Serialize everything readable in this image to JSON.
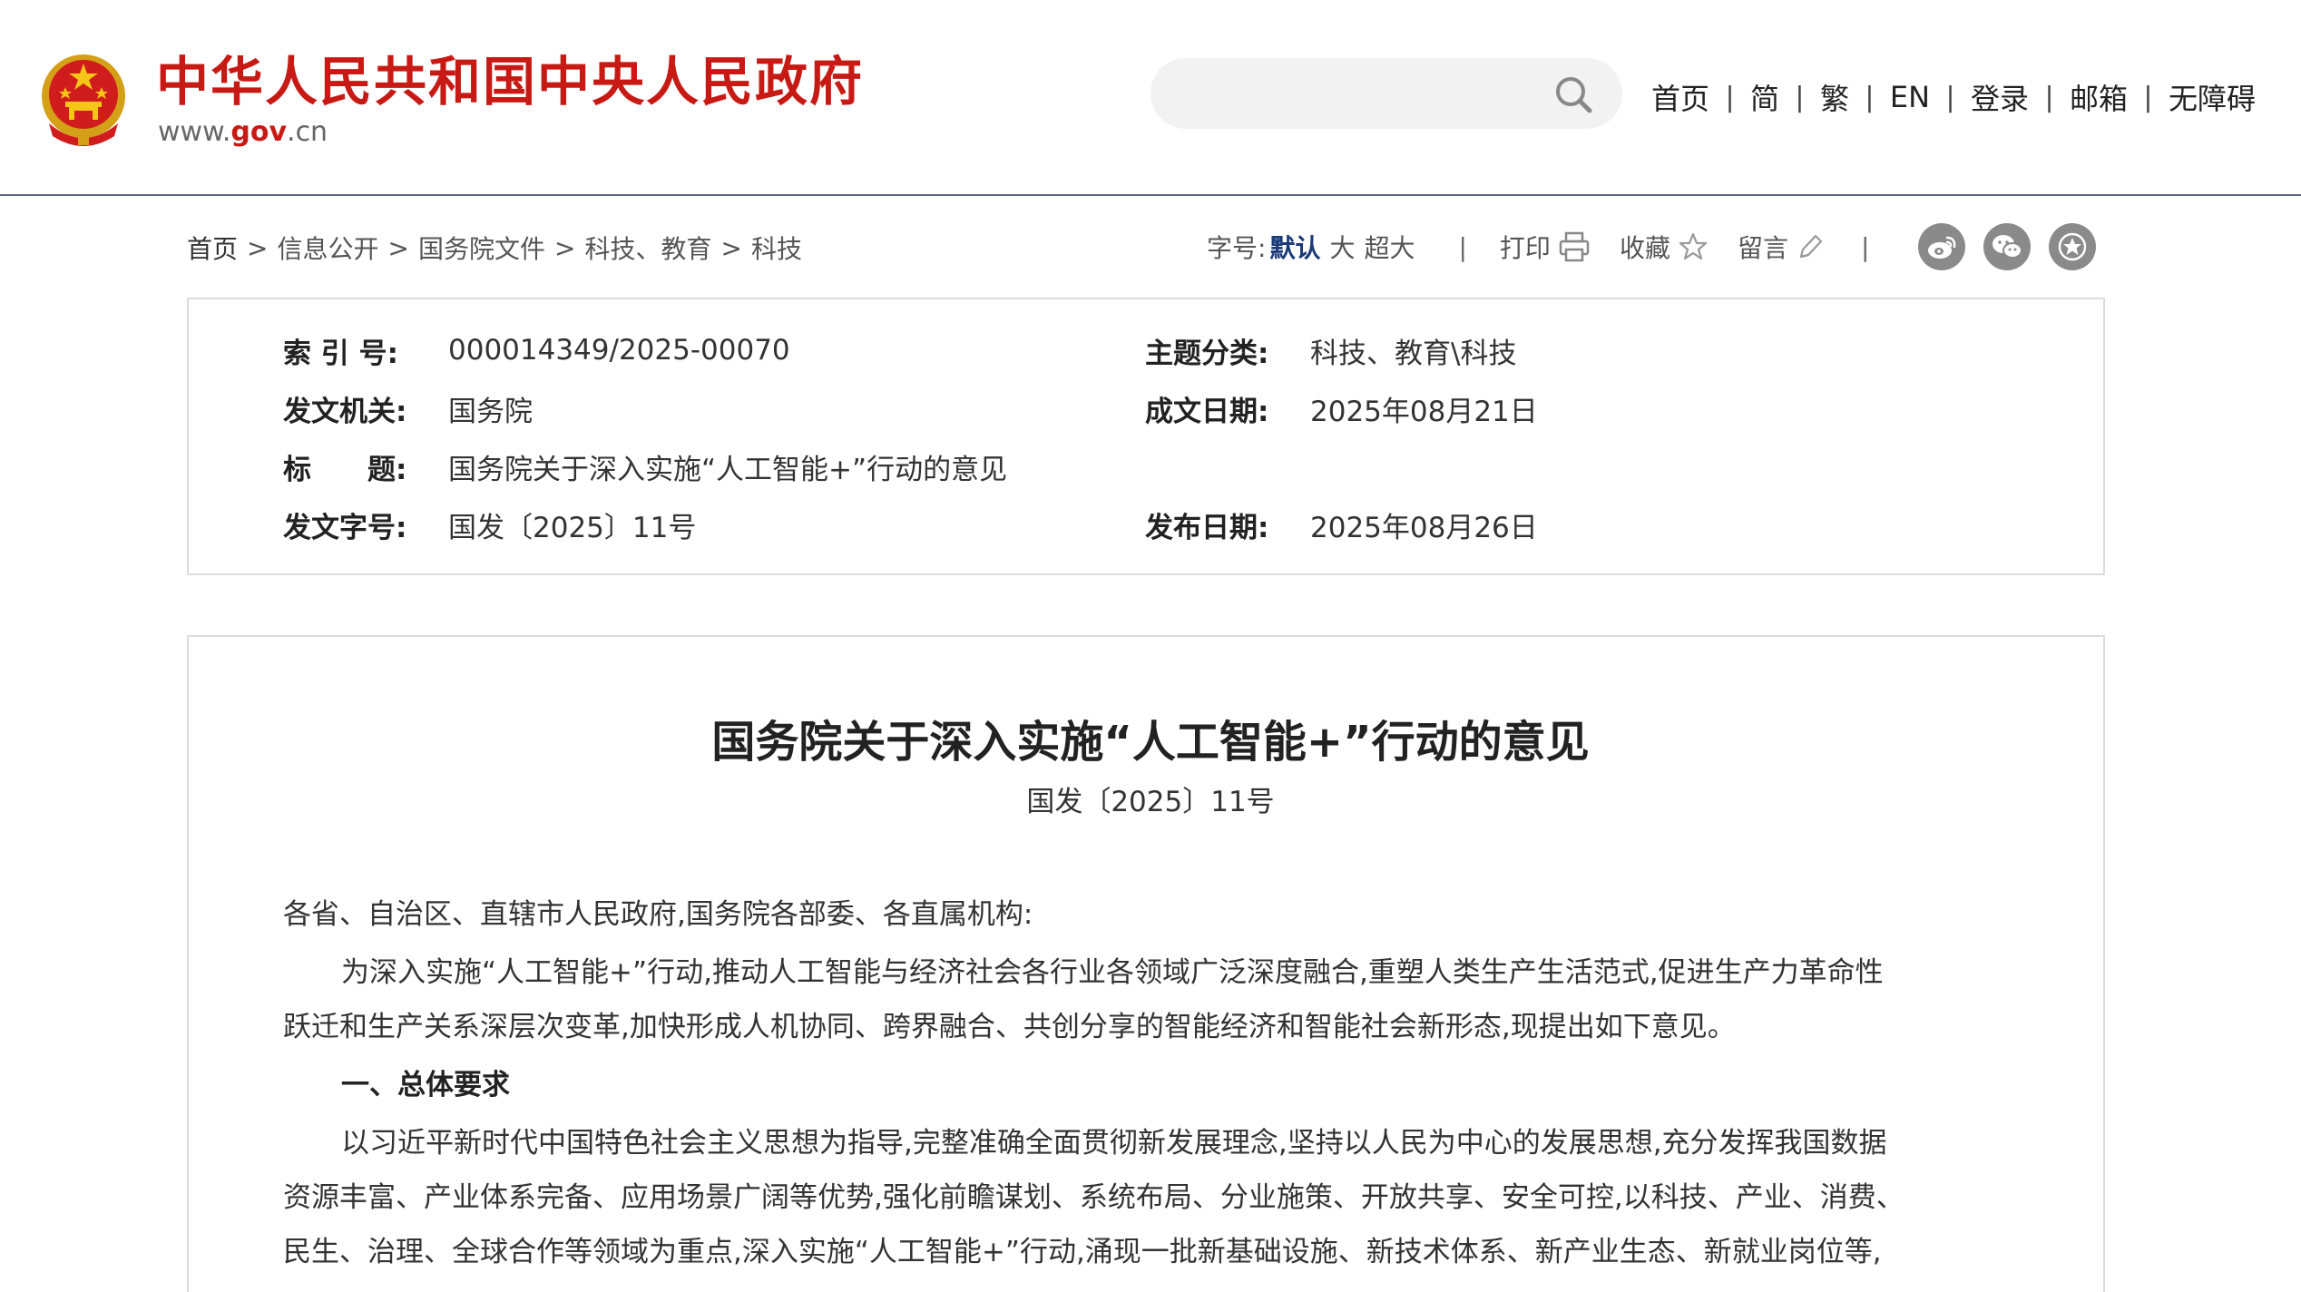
{
  "header": {
    "site_title": "中华人民共和国中央人民政府",
    "site_url_prefix": "www.",
    "site_url_domain": "gov",
    "site_url_suffix": ".cn",
    "search": {
      "value": "",
      "placeholder": ""
    },
    "nav": [
      "首页",
      "简",
      "繁",
      "EN",
      "登录",
      "邮箱",
      "无障碍"
    ],
    "nav_separator": "|"
  },
  "breadcrumb": [
    "首页",
    "信息公开",
    "国务院文件",
    "科技、教育",
    "科技"
  ],
  "breadcrumb_sep": ">",
  "tools": {
    "font_size_label": "字号:",
    "font_sizes": [
      "默认",
      "大",
      "超大"
    ],
    "active_font_size": "默认",
    "divider": "|",
    "print": "打印",
    "favorite": "收藏",
    "comment": "留言"
  },
  "share_icons": [
    "weibo-icon",
    "wechat-icon",
    "star-badge-icon"
  ],
  "metadata": {
    "index_label": "索 引 号:",
    "index_value": "000014349/2025-00070",
    "category_label": "主题分类:",
    "category_value": "科技、教育\\科技",
    "issuer_label": "发文机关:",
    "issuer_value": "国务院",
    "written_date_label": "成文日期:",
    "written_date_value": "2025年08月21日",
    "title_label": "标　　题:",
    "title_value": "国务院关于深入实施“人工智能+”行动的意见",
    "doc_number_label": "发文字号:",
    "doc_number_value": "国发〔2025〕11号",
    "publish_date_label": "发布日期:",
    "publish_date_value": "2025年08月26日"
  },
  "article": {
    "title": "国务院关于深入实施“人工智能+”行动的意见",
    "doc_number": "国发〔2025〕11号",
    "salutation": "各省、自治区、直辖市人民政府,国务院各部委、各直属机构:",
    "p1_line1": "为深入实施“人工智能+”行动,推动人工智能与经济社会各行业各领域广泛深度融合,重塑人类生产生活范式,促进生产力革命性",
    "p1_line2": "跃迁和生产关系深层次变革,加快形成人机协同、跨界融合、共创分享的智能经济和智能社会新形态,现提出如下意见。",
    "section1": "一、总体要求",
    "p2_line1": "以习近平新时代中国特色社会主义思想为指导,完整准确全面贯彻新发展理念,坚持以人民为中心的发展思想,充分发挥我国数据",
    "p2_line2": "资源丰富、产业体系完备、应用场景广阔等优势,强化前瞻谋划、系统布局、分业施策、开放共享、安全可控,以科技、产业、消费、",
    "p2_line3": "民生、治理、全球合作等领域为重点,深入实施“人工智能+”行动,涌现一批新基础设施、新技术体系、新产业生态、新就业岗位等,"
  },
  "colors": {
    "brand_red": "#c81a14",
    "active_blue": "#1a3a78",
    "header_rule": "#5a6a7c",
    "box_border": "#dcdcdc"
  }
}
